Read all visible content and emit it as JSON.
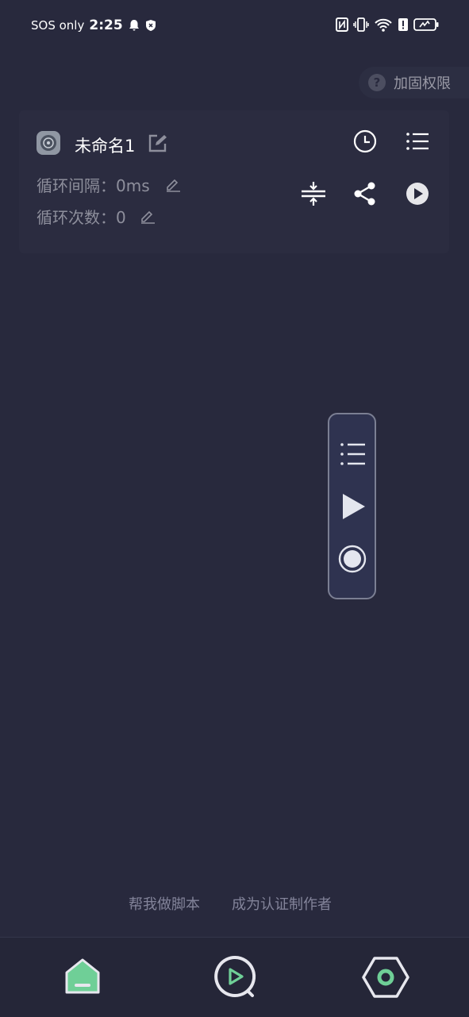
{
  "status_bar": {
    "carrier": "SOS only",
    "time": "2:25"
  },
  "permission": {
    "label": "加固权限"
  },
  "script": {
    "name": "未命名1",
    "interval_label": "循环间隔：",
    "interval_value": "0ms",
    "count_label": "循环次数：",
    "count_value": "0"
  },
  "footer": {
    "help_link": "帮我做脚本",
    "author_link": "成为认证制作者"
  },
  "nav": {
    "items": [
      "home-tab",
      "run-tab",
      "settings-tab"
    ]
  },
  "colors": {
    "background": "#28293d",
    "card": "#2b2c40",
    "accent_green": "#6fcf97",
    "muted_text": "#8e8f9c"
  }
}
